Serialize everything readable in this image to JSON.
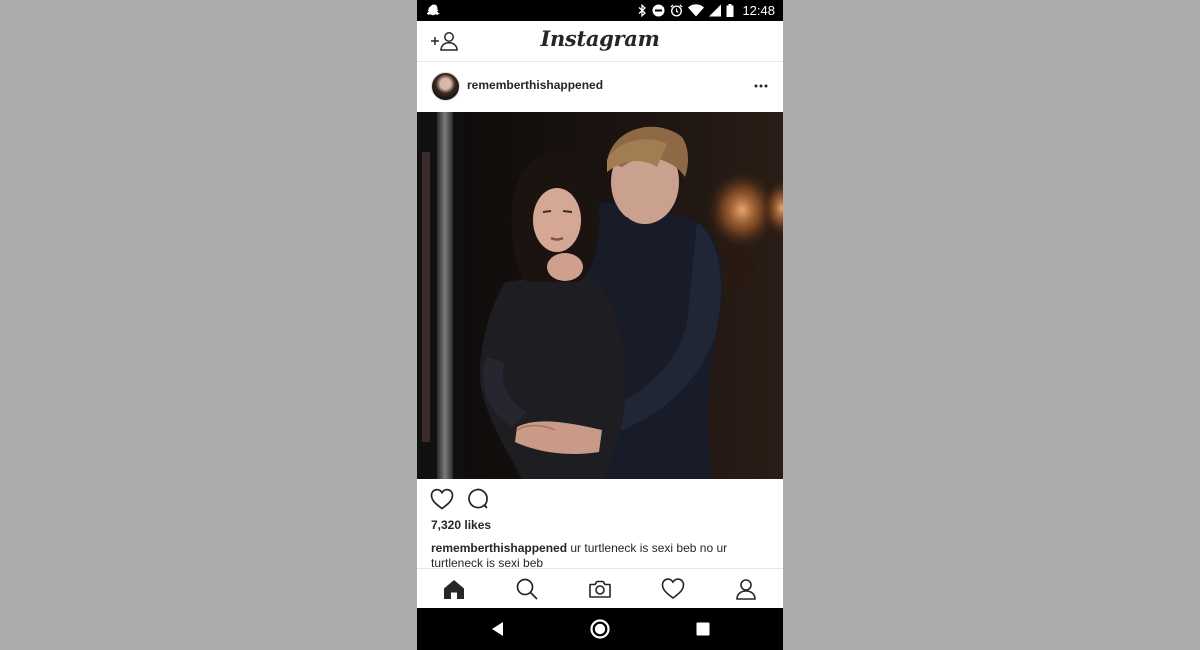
{
  "status_bar": {
    "time": "12:48",
    "icons": [
      "snapchat-icon",
      "bluetooth-icon",
      "do-not-disturb-icon",
      "alarm-icon",
      "wifi-icon",
      "signal-icon",
      "battery-icon"
    ]
  },
  "header": {
    "title": "Instagram",
    "add_user_icon": "add-user-icon"
  },
  "post": {
    "username": "rememberthishappened",
    "more_icon": "more-icon",
    "likes": "7,320 likes",
    "caption_user": "rememberthishappened",
    "caption_text": " ur turtleneck is sexi beb no ur turtleneck is sexi beb"
  },
  "bottom_nav": {
    "items": [
      "home-icon",
      "search-icon",
      "camera-icon",
      "heart-icon",
      "profile-icon"
    ]
  },
  "android_nav": {
    "items": [
      "back-icon",
      "home-circle-icon",
      "recents-icon"
    ]
  }
}
